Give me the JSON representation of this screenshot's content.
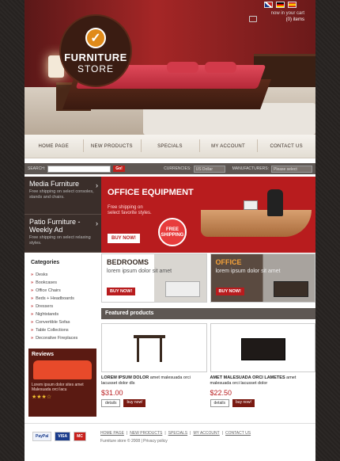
{
  "brand": {
    "line1": "FURNITURE",
    "line2": "STORE"
  },
  "cart": {
    "label": "now in your cart",
    "items": "(0) items"
  },
  "nav": [
    "HOME PAGE",
    "NEW PRODUCTS",
    "SPECIALS",
    "MY ACCOUNT",
    "CONTACT US"
  ],
  "search": {
    "label": "SEARCH:",
    "go": "Go!",
    "currencies_label": "CURRENCIES:",
    "currency": "US Dollar",
    "manufacturers_label": "MANUFACTURERS:",
    "manufacturer": "Please select"
  },
  "side_promos": [
    {
      "title": "Media Furniture",
      "desc": "Free shipping on select consoles, stands and chairs."
    },
    {
      "title": "Patio Furniture - Weekly Ad",
      "desc": "Free shipping on select relaxing styles."
    }
  ],
  "office_banner": {
    "title": "OFFICE EQUIPMENT",
    "subtitle": "Free shipping on select favorite styles.",
    "buy": "BUY NOW!",
    "badge_line1": "FREE",
    "badge_line2": "SHIPPING"
  },
  "categories": {
    "title": "Categories",
    "items": [
      "Desks",
      "Bookcases",
      "Office Chairs",
      "Beds + Headboards",
      "Dressers",
      "Nightstands",
      "Convertible Sofas",
      "Table Collections",
      "Decorative Fireplaces"
    ]
  },
  "reviews": {
    "title": "Reviews",
    "text": "Lorem ipsum dolor sites amet Malesuada orci lacu",
    "stars": "★★★☆"
  },
  "tiles": [
    {
      "title": "BEDROOMS",
      "desc": "lorem ipsum dolor sit amet",
      "buy": "BUY NOW!"
    },
    {
      "title": "OFFICE",
      "desc": "lorem ipsum dolor sit amet",
      "buy": "BUY NOW!"
    }
  ],
  "featured_title": "Featured products",
  "products": [
    {
      "name_bold": "LOREM IPSUM DOLOR",
      "name_rest": "amet malesuada orci lacusset dolor dls",
      "price": "$31.00",
      "details": "details",
      "buy": "buy now!"
    },
    {
      "name_bold": "AMET MALESUADA ORCI LAMETES",
      "name_rest": "amet malesuada orci lacusset dolor",
      "price": "$22.50",
      "details": "details",
      "buy": "buy now!"
    }
  ],
  "footer": {
    "payments": [
      "PayPal",
      "VISA",
      "MC"
    ],
    "links": [
      "HOME PAGE",
      "NEW PRODUCTS",
      "SPECIALS",
      "MY ACCOUNT",
      "CONTACT US"
    ],
    "copyright": "Furniture store © 2008  |  Privacy policy"
  }
}
